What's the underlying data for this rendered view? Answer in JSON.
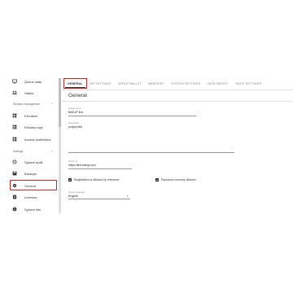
{
  "sidebar": {
    "items": [
      {
        "label": "Queue stats",
        "icon": "monitor-icon"
      },
      {
        "label": "Status",
        "icon": "laptop-icon"
      },
      {
        "label": "Elevators",
        "icon": "grid-icon"
      },
      {
        "label": "Elevator logs",
        "icon": "grid-icon"
      },
      {
        "label": "Access restrictions",
        "icon": "grid-icon"
      },
      {
        "label": "System audit",
        "icon": "history-icon"
      },
      {
        "label": "Backups",
        "icon": "save-icon"
      },
      {
        "label": "General",
        "icon": "gear-icon"
      },
      {
        "label": "Licenses",
        "icon": "key-icon"
      },
      {
        "label": "System info",
        "icon": "info-icon"
      }
    ],
    "sections": [
      {
        "label": "Elevator management"
      },
      {
        "label": "Settings"
      }
    ],
    "active": "General"
  },
  "tabs": [
    {
      "label": "GENERAL"
    },
    {
      "label": "SIP SETTINGS"
    },
    {
      "label": "APPLE WALLET"
    },
    {
      "label": "MARKERS"
    },
    {
      "label": "SYSTEM SETTINGS"
    },
    {
      "label": "DATA IMPORT"
    },
    {
      "label": "MQTT SETTINGS"
    }
  ],
  "main": {
    "section_title": "General",
    "project_name_label": "Project name",
    "project_name_value": "BAS-IP link",
    "description_label": "Description",
    "description_value": "project link",
    "server_url_label": "Server url",
    "server_url_value": "https://link.basip.com",
    "registration_label": "Registration is allowed by reference",
    "password_recovery_label": "Password recovery allowed",
    "language_label": "System language",
    "language_value": "English"
  },
  "colors": {
    "highlight": "#c62828",
    "checkbox": "#222222"
  }
}
